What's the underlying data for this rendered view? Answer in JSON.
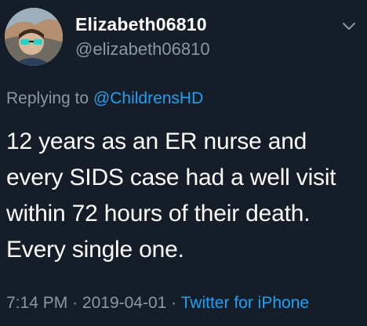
{
  "author": {
    "display_name": "Elizabeth06810",
    "handle": "@elizabeth06810"
  },
  "reply": {
    "prefix": "Replying to",
    "mention": "@ChildrensHD"
  },
  "tweet": {
    "lines": [
      "12 years as an ER nurse and",
      "every SIDS case  had a well visit",
      "within 72 hours of their death.",
      "Every single one."
    ]
  },
  "meta": {
    "time": "7:14 PM",
    "separator": "·",
    "date": "2019-04-01",
    "source": "Twitter for iPhone"
  },
  "icons": {
    "caret": "chevron-down-icon"
  },
  "colors": {
    "background": "#141d28",
    "muted": "#8899a6",
    "link": "#1da1f2",
    "text": "#ffffff"
  }
}
